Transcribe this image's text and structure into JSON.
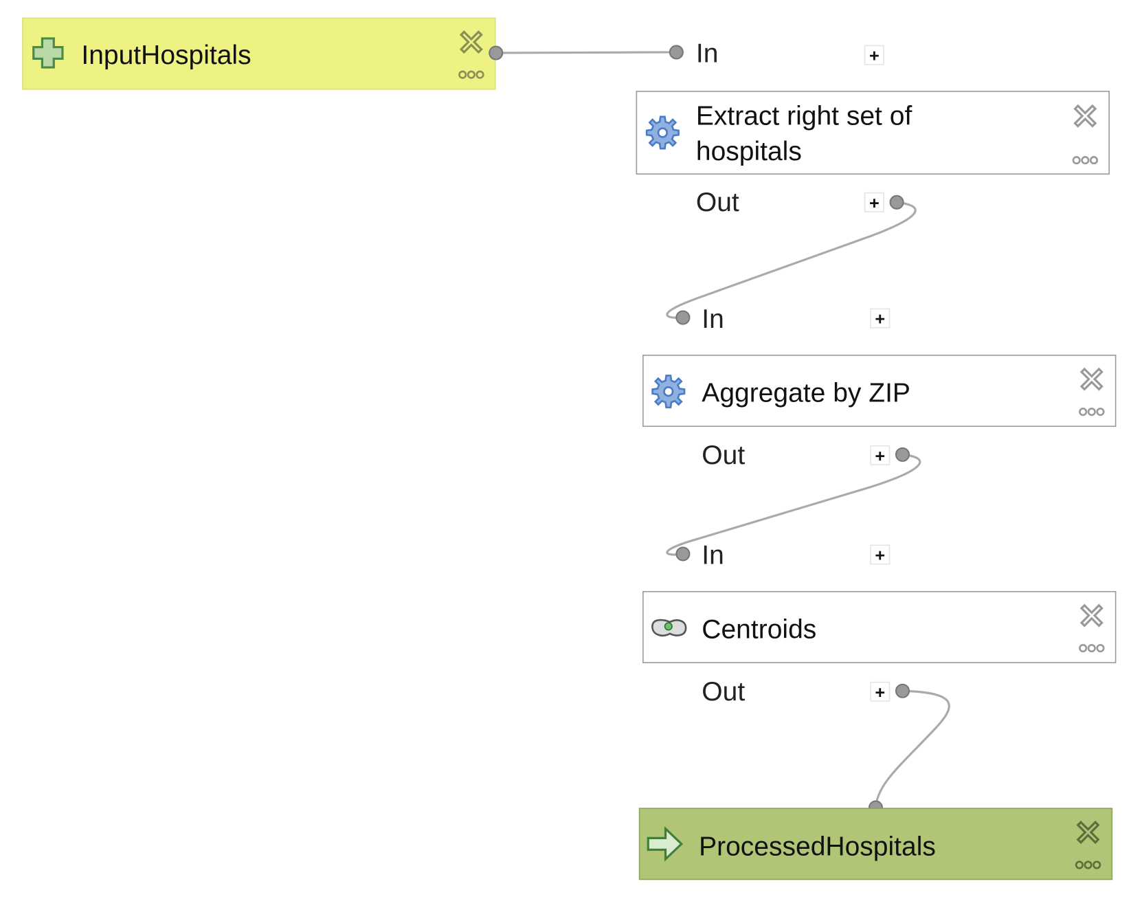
{
  "nodes": {
    "input": {
      "label": "InputHospitals",
      "icon": "plus-icon",
      "color": "#eef283"
    },
    "extract": {
      "label_line1": "Extract right set of",
      "label_line2": "hospitals",
      "icon": "gear-icon",
      "in_label": "In",
      "out_label": "Out"
    },
    "aggregate": {
      "label": "Aggregate by ZIP",
      "icon": "gear-icon",
      "in_label": "In",
      "out_label": "Out"
    },
    "centroids": {
      "label": "Centroids",
      "icon": "centroids-icon",
      "in_label": "In",
      "out_label": "Out"
    },
    "output": {
      "label": "ProcessedHospitals",
      "icon": "arrow-right-icon",
      "color": "#b0c575"
    }
  },
  "controls": {
    "plus": "+"
  }
}
